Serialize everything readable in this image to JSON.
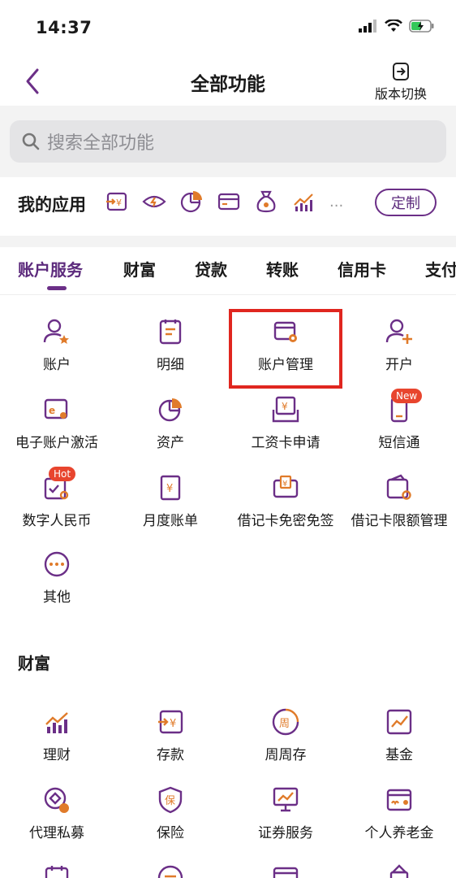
{
  "status": {
    "time": "14:37"
  },
  "nav": {
    "title": "全部功能",
    "switch_label": "版本切换"
  },
  "search": {
    "placeholder": "搜索全部功能"
  },
  "my_apps": {
    "label": "我的应用",
    "icons": [
      "deposit-icon",
      "eye-icon",
      "pie-chart-icon",
      "card-icon",
      "money-bag-icon",
      "bar-chart-icon"
    ],
    "more": "...",
    "customize": "定制"
  },
  "tabs": [
    "账户服务",
    "财富",
    "贷款",
    "转账",
    "信用卡",
    "支付"
  ],
  "account_services": [
    {
      "label": "账户",
      "icon": "user-star-icon"
    },
    {
      "label": "明细",
      "icon": "clipboard-icon"
    },
    {
      "label": "账户管理",
      "icon": "card-settings-icon"
    },
    {
      "label": "开户",
      "icon": "user-add-icon"
    },
    {
      "label": "电子账户激活",
      "icon": "e-card-icon"
    },
    {
      "label": "资产",
      "icon": "pie-chart-icon"
    },
    {
      "label": "工资卡申请",
      "icon": "salary-card-icon"
    },
    {
      "label": "短信通",
      "icon": "sms-icon",
      "badge": "New"
    },
    {
      "label": "数字人民币",
      "icon": "digital-rmb-icon",
      "badge": "Hot"
    },
    {
      "label": "月度账单",
      "icon": "bill-icon"
    },
    {
      "label": "借记卡免密免签",
      "icon": "debit-card-icon"
    },
    {
      "label": "借记卡限额管理",
      "icon": "card-limit-icon"
    },
    {
      "label": "其他",
      "icon": "more-circle-icon"
    }
  ],
  "wealth": {
    "title": "财富",
    "items": [
      {
        "label": "理财",
        "icon": "bar-chart-icon"
      },
      {
        "label": "存款",
        "icon": "deposit-icon"
      },
      {
        "label": "周周存",
        "icon": "weekly-icon"
      },
      {
        "label": "基金",
        "icon": "fund-chart-icon"
      },
      {
        "label": "代理私募",
        "icon": "private-fund-icon"
      },
      {
        "label": "保险",
        "icon": "insurance-icon"
      },
      {
        "label": "证券服务",
        "icon": "securities-icon"
      },
      {
        "label": "个人养老金",
        "icon": "pension-card-icon"
      }
    ]
  },
  "colors": {
    "accent": "#6b2f87",
    "accent_orange": "#e07b2a",
    "highlight": "#e0261f"
  }
}
